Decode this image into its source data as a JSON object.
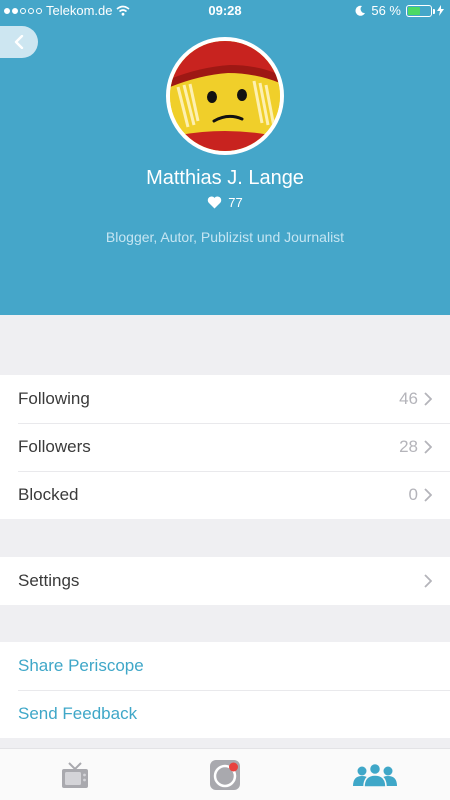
{
  "status_bar": {
    "carrier": "Telekom.de",
    "time": "09:28",
    "battery_percent": "56 %",
    "battery_level": 0.56
  },
  "profile": {
    "name": "Matthias J. Lange",
    "likes": "77",
    "bio": "Blogger, Autor, Publizist und Journalist"
  },
  "social": [
    {
      "label": "Following",
      "value": "46"
    },
    {
      "label": "Followers",
      "value": "28"
    },
    {
      "label": "Blocked",
      "value": "0"
    }
  ],
  "settings": {
    "label": "Settings"
  },
  "links": [
    {
      "label": "Share Periscope"
    },
    {
      "label": "Send Feedback"
    }
  ],
  "tabbar": {
    "tabs": [
      "tv-icon",
      "broadcast-icon",
      "people-icon"
    ],
    "active_color": "#3fa7c8",
    "inactive_color": "#a9a9ae"
  },
  "colors": {
    "header": "#45a6c9",
    "link": "#3fa7c8"
  }
}
